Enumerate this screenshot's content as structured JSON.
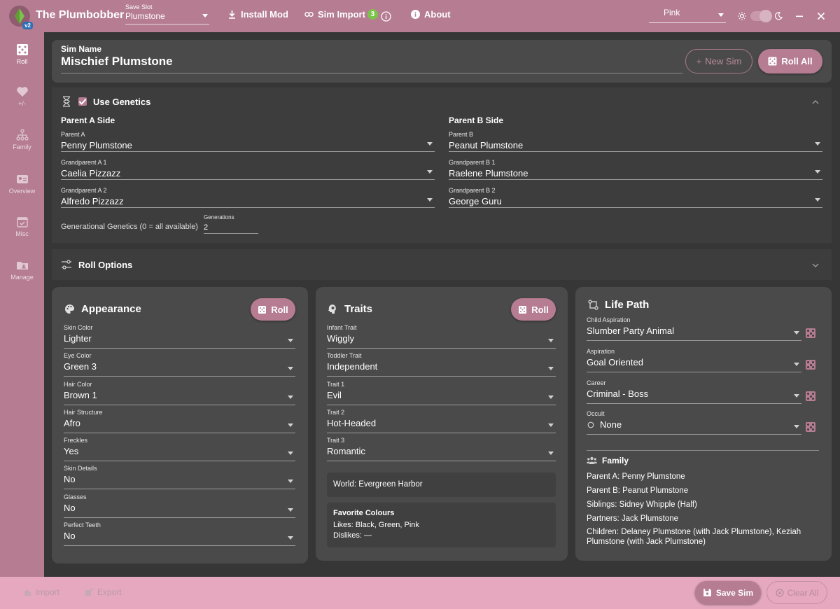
{
  "app": {
    "title": "The Plumbobber",
    "version": "v2"
  },
  "titlebar": {
    "save_slot_label": "Save Slot",
    "save_slot_value": "Plumstone",
    "install_mod": "Install Mod",
    "sim_import": "Sim Import",
    "sim_import_badge": "3",
    "about": "About",
    "theme": "Pink"
  },
  "sidebar": {
    "items": [
      {
        "label": "Roll",
        "icon": "dice-icon"
      },
      {
        "label": "+/-",
        "icon": "heart-icon"
      },
      {
        "label": "Family",
        "icon": "family-tree-icon"
      },
      {
        "label": "Overview",
        "icon": "id-card-icon"
      },
      {
        "label": "Misc",
        "icon": "calendar-check-icon"
      },
      {
        "label": "Manage",
        "icon": "folder-user-icon"
      }
    ]
  },
  "sim": {
    "name_label": "Sim Name",
    "name_value": "Mischief Plumstone",
    "new_sim": "New Sim",
    "roll_all": "Roll All"
  },
  "genetics": {
    "title": "Use Genetics",
    "parent_a_side": "Parent A Side",
    "parent_b_side": "Parent B Side",
    "fields_a": [
      {
        "label": "Parent A",
        "value": "Penny Plumstone"
      },
      {
        "label": "Grandparent A 1",
        "value": "Caelia Pizzazz"
      },
      {
        "label": "Grandparent A 2",
        "value": "Alfredo Pizzazz"
      }
    ],
    "fields_b": [
      {
        "label": "Parent B",
        "value": "Peanut Plumstone"
      },
      {
        "label": "Grandparent B 1",
        "value": "Raelene Plumstone"
      },
      {
        "label": "Grandparent B 2",
        "value": "George Guru"
      }
    ],
    "generational_label": "Generational Genetics (0 = all available)",
    "generations_label": "Generations",
    "generations_value": "2"
  },
  "roll_options": {
    "title": "Roll Options"
  },
  "appearance": {
    "title": "Appearance",
    "roll": "Roll",
    "fields": [
      {
        "label": "Skin Color",
        "value": "Lighter"
      },
      {
        "label": "Eye Color",
        "value": "Green 3"
      },
      {
        "label": "Hair Color",
        "value": "Brown 1"
      },
      {
        "label": "Hair Structure",
        "value": "Afro"
      },
      {
        "label": "Freckles",
        "value": "Yes"
      },
      {
        "label": "Skin Details",
        "value": "No"
      },
      {
        "label": "Glasses",
        "value": "No"
      },
      {
        "label": "Perfect Teeth",
        "value": "No"
      }
    ]
  },
  "traits": {
    "title": "Traits",
    "roll": "Roll",
    "fields": [
      {
        "label": "Infant Trait",
        "value": "Wiggly"
      },
      {
        "label": "Toddler Trait",
        "value": "Independent"
      },
      {
        "label": "Trait 1",
        "value": "Evil"
      },
      {
        "label": "Trait 2",
        "value": "Hot-Headed"
      },
      {
        "label": "Trait 3",
        "value": "Romantic"
      }
    ],
    "world": "World: Evergreen Harbor",
    "fav_title": "Favorite Colours",
    "likes": "Likes: Black, Green, Pink",
    "dislikes": "Dislikes: —"
  },
  "life_path": {
    "title": "Life Path",
    "fields": [
      {
        "label": "Child Aspiration",
        "value": "Slumber Party Animal"
      },
      {
        "label": "Aspiration",
        "value": "Goal Oriented"
      },
      {
        "label": "Career",
        "value": "Criminal - Boss"
      },
      {
        "label": "Occult",
        "value": "None"
      }
    ],
    "family_title": "Family",
    "family": [
      "Parent A: Penny Plumstone",
      "Parent B: Peanut Plumstone",
      "Siblings: Sidney Whipple (Half)",
      "Partners: Jack Plumstone",
      "Children: Delaney Plumstone (with Jack Plumstone), Keziah Plumstone (with Jack Plumstone)"
    ]
  },
  "footer": {
    "import": "Import",
    "export": "Export",
    "save_sim": "Save Sim",
    "clear_all": "Clear All"
  },
  "colors": {
    "accent": "#b57c92",
    "footer": "#e5a8bf",
    "badge": "#7cc34a"
  }
}
